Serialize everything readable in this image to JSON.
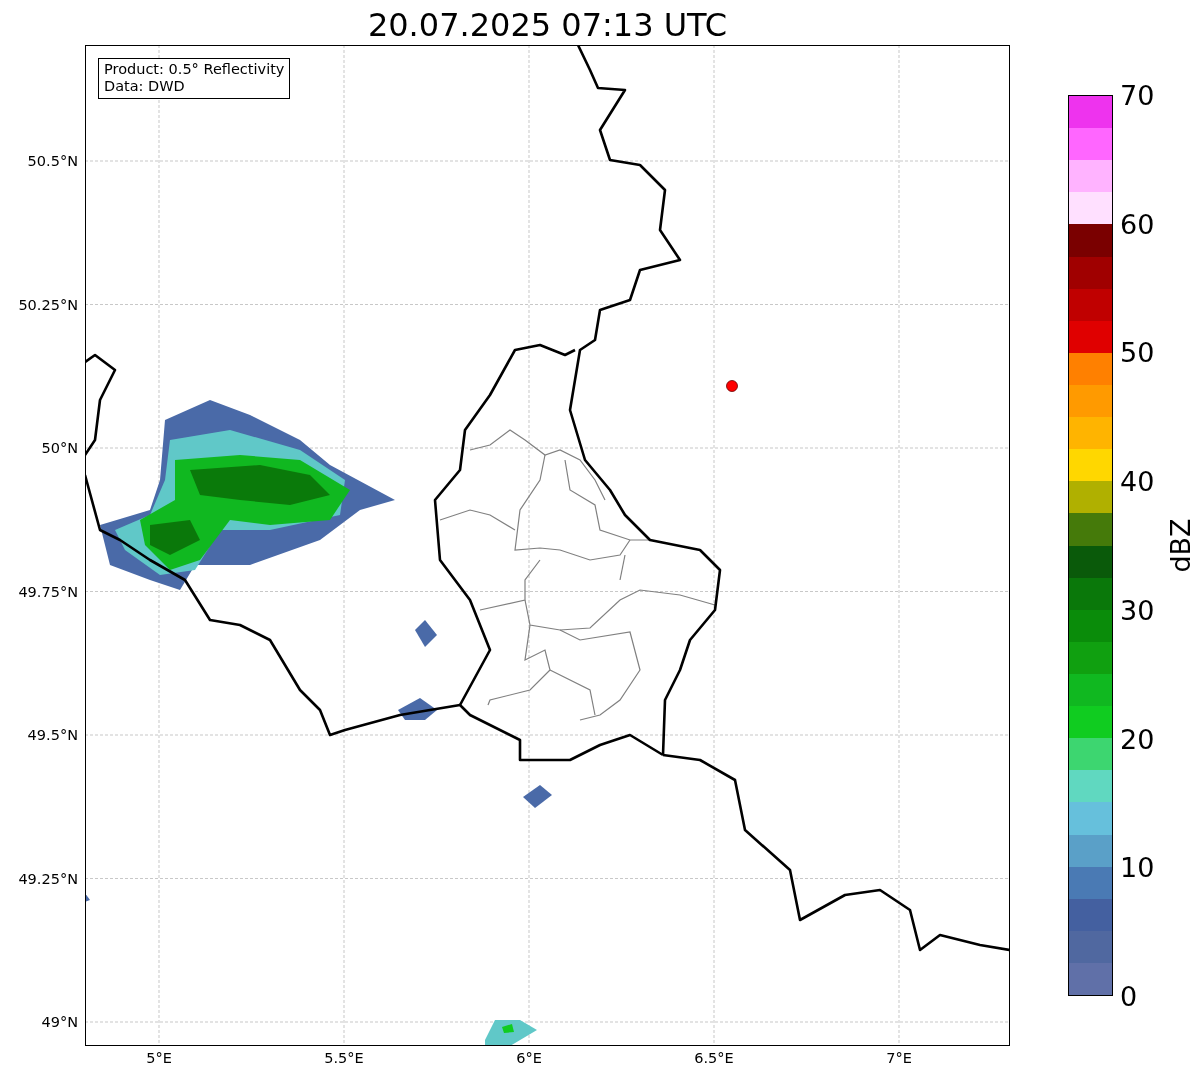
{
  "title": "20.07.2025 07:13 UTC",
  "info": [
    "Product: 0.5° Reflectivity",
    "Data: DWD"
  ],
  "lat_ticks": [
    "50.5°N",
    "50.25°N",
    "50°N",
    "49.75°N",
    "49.5°N",
    "49.25°N",
    "49°N"
  ],
  "lon_ticks": [
    "5°E",
    "5.5°E",
    "6°E",
    "6.5°E",
    "7°E"
  ],
  "colorbar": {
    "label": "dBZ",
    "ticks": [
      "70",
      "60",
      "50",
      "40",
      "30",
      "20",
      "10",
      "0"
    ],
    "segments": [
      {
        "color": "#ee33ee"
      },
      {
        "color": "#ff66ff"
      },
      {
        "color": "#ffb3ff"
      },
      {
        "color": "#ffe0ff"
      },
      {
        "color": "#7a0000"
      },
      {
        "color": "#a00000"
      },
      {
        "color": "#c00000"
      },
      {
        "color": "#e00000"
      },
      {
        "color": "#ff8000"
      },
      {
        "color": "#ff9a00"
      },
      {
        "color": "#ffb400"
      },
      {
        "color": "#ffd700"
      },
      {
        "color": "#b0b000"
      },
      {
        "color": "#457a0a"
      },
      {
        "color": "#0a5a0a"
      },
      {
        "color": "#0a780a"
      },
      {
        "color": "#0a8c0a"
      },
      {
        "color": "#10a010"
      },
      {
        "color": "#10b820"
      },
      {
        "color": "#10cc20"
      },
      {
        "color": "#3dd670"
      },
      {
        "color": "#60d8c0"
      },
      {
        "color": "#66c0dc"
      },
      {
        "color": "#5aa0c8"
      },
      {
        "color": "#4a7ab4"
      },
      {
        "color": "#4460a0"
      },
      {
        "color": "#5068a0"
      },
      {
        "color": "#6070a8"
      }
    ]
  }
}
